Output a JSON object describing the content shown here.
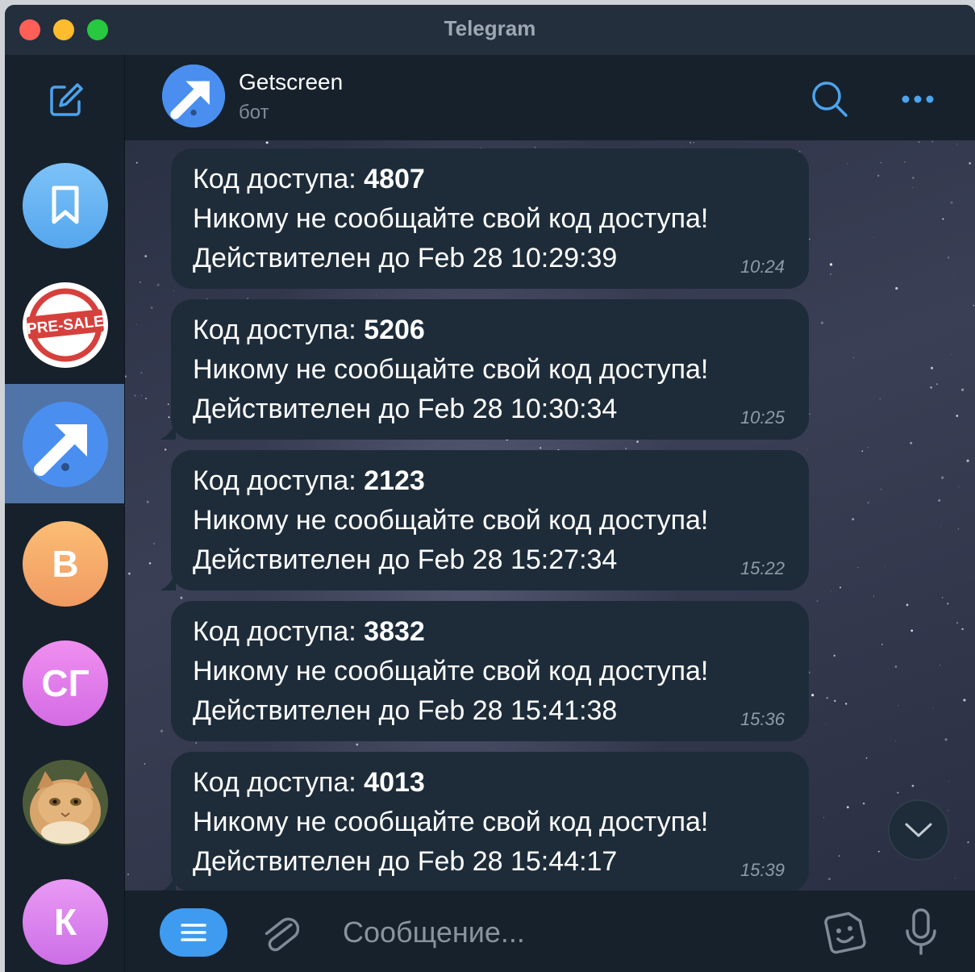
{
  "window": {
    "title": "Telegram"
  },
  "sidebar": {
    "compose_icon": "compose-icon",
    "chats": [
      {
        "name": "saved-messages",
        "icon": "bookmark-icon",
        "color": "#6fb6f5"
      },
      {
        "name": "presale-channel",
        "badge_text": "PRE-SALE",
        "color": "#d6403c"
      },
      {
        "name": "getscreen-bot",
        "icon": "arrow-up-right-icon",
        "color": "#4a8ff0",
        "active": true
      },
      {
        "name": "chat-b",
        "initials": "В",
        "color": "#f4a968"
      },
      {
        "name": "chat-sg",
        "initials": "СГ",
        "color": "#e07ae6"
      },
      {
        "name": "chat-cat",
        "icon": "cat-photo",
        "color": "#a07a55"
      },
      {
        "name": "chat-k",
        "initials": "К",
        "color": "#d677f0"
      }
    ]
  },
  "header": {
    "name": "Getscreen",
    "status": "бот",
    "search_icon": "search-icon",
    "more_icon": "more-icon"
  },
  "messages": [
    {
      "label": "Код доступа: ",
      "code": "4807",
      "warning": "Никому не сообщайте свой код доступа!",
      "valid": "Действителен до Feb 28 10:29:39",
      "time": "10:24"
    },
    {
      "label": "Код доступа: ",
      "code": "5206",
      "warning": "Никому не сообщайте свой код доступа!",
      "valid": "Действителен до Feb 28 10:30:34",
      "time": "10:25"
    },
    {
      "label": "Код доступа: ",
      "code": "2123",
      "warning": "Никому не сообщайте свой код доступа!",
      "valid": "Действителен до Feb 28 15:27:34",
      "time": "15:22"
    },
    {
      "label": "Код доступа: ",
      "code": "3832",
      "warning": "Никому не сообщайте свой код доступа!",
      "valid": "Действителен до Feb 28 15:41:38",
      "time": "15:36"
    },
    {
      "label": "Код доступа: ",
      "code": "4013",
      "warning": "Никому не сообщайте свой код доступа!",
      "valid": "Действителен до Feb 28 15:44:17",
      "time": "15:39"
    }
  ],
  "composer": {
    "placeholder": "Сообщение...",
    "menu_icon": "menu-icon",
    "attach_icon": "paperclip-icon",
    "sticker_icon": "sticker-icon",
    "mic_icon": "microphone-icon"
  }
}
